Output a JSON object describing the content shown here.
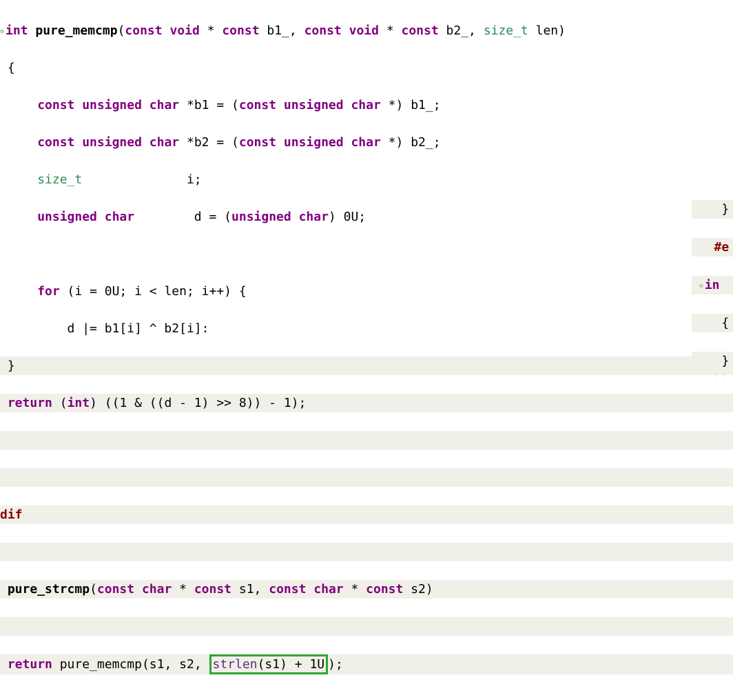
{
  "code": {
    "fn1": {
      "kw_int": "int",
      "name": "pure_memcmp",
      "sig_open": "(",
      "kw_const1": "const",
      "kw_void1": "void",
      "kw_star1": "*",
      "kw_const2": "const",
      "param_b1": "b1_",
      "comma1": ",",
      "kw_const3": "const",
      "kw_void2": "void",
      "kw_star2": "*",
      "kw_const4": "const",
      "param_b2": "b2_",
      "comma2": ",",
      "type_sizet": "size_t",
      "param_len": "len",
      "sig_close": ")",
      "brace_open": "{",
      "l3": {
        "kw_const": "const",
        "kw_unsigned": "unsigned",
        "kw_char": "char",
        "star": "*",
        "var": "b1",
        "eq": "=",
        "cast_open": "(",
        "kw_const2": "const",
        "kw_unsigned2": "unsigned",
        "kw_char2": "char",
        "star2": "*",
        "cast_close": ")",
        "src": "b1_",
        "semi": ";"
      },
      "l4": {
        "kw_const": "const",
        "kw_unsigned": "unsigned",
        "kw_char": "char",
        "star": "*",
        "var": "b2",
        "eq": "=",
        "cast_open": "(",
        "kw_const2": "const",
        "kw_unsigned2": "unsigned",
        "kw_char2": "char",
        "star2": "*",
        "cast_close": ")",
        "src": "b2_",
        "semi": ";"
      },
      "l5": {
        "type_sizet": "size_t",
        "var": "i",
        "semi": ";"
      },
      "l6": {
        "kw_unsigned": "unsigned",
        "kw_char": "char",
        "var": "d",
        "eq": "=",
        "cast_open": "(",
        "kw_unsigned2": "unsigned",
        "kw_char2": "char",
        "cast_close": ")",
        "val": "0U",
        "semi": ";"
      },
      "l8": {
        "kw_for": "for",
        "open": "(",
        "init": "i = 0U",
        "semi1": ";",
        "cond": "i < len",
        "semi2": ";",
        "inc": "i++",
        "close": ")",
        "brace": "{"
      },
      "l9": {
        "stmt": "d |= b1[i] ^ b2[i]:"
      },
      "brace_close": "}",
      "l11": {
        "kw_return": "return",
        "cast_open": "(",
        "kw_int": "int",
        "cast_close": ")",
        "expr": "((1 & ((d - 1) >> 8)) - 1)",
        "semi": ";"
      }
    },
    "pp": {
      "endif_part": "dif",
      "hash_e": "#e"
    },
    "fn2": {
      "prefix": " ",
      "name": "pure_strcmp",
      "sig_open": "(",
      "kw_const1": "const",
      "kw_char1": "char",
      "kw_star1": "*",
      "kw_const2": "const",
      "param_s1": "s1",
      "comma": ",",
      "kw_const3": "const",
      "kw_char2": "char",
      "kw_star2": "*",
      "kw_const4": "const",
      "param_s2": "s2",
      "sig_close": ")",
      "fn_body": {
        "kw_return": "return",
        "call": "pure_memcmp",
        "open": "(",
        "a1": "s1",
        "c1": ",",
        "a2": "s2",
        "c2": ",",
        "strlen": "strlen",
        "sopen": "(",
        "sarg": "s1",
        "sclose": ")",
        "plus": "+",
        "one": "1U",
        "close": ")",
        "semi": ";"
      }
    },
    "right": {
      "brace1": "}",
      "int_marker": "in",
      "brace_open": "{",
      "brace2": "}"
    }
  }
}
